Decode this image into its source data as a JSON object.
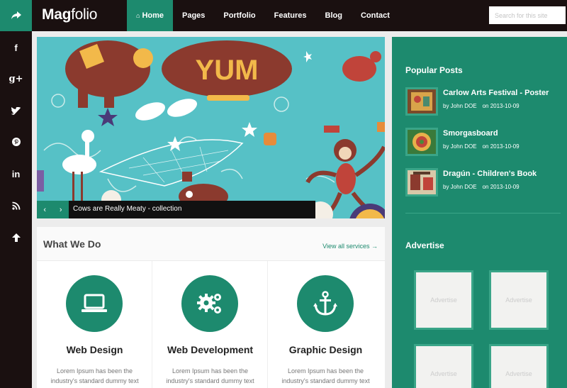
{
  "header": {
    "logo_bold": "Mag",
    "logo_rest": "folio",
    "nav": [
      {
        "label": "Home",
        "icon": "home-icon"
      },
      {
        "label": "Pages"
      },
      {
        "label": "Portfolio"
      },
      {
        "label": "Features"
      },
      {
        "label": "Blog"
      },
      {
        "label": "Contact"
      }
    ],
    "search_placeholder": "Search for this site"
  },
  "social": [
    "f",
    "g+",
    "twitter",
    "pinterest",
    "in",
    "rss",
    "up"
  ],
  "hero": {
    "banner_text": "YUM",
    "caption": "Cows are Really Meaty - collection"
  },
  "services": {
    "title": "What We Do",
    "view_all": "View all services →",
    "items": [
      {
        "name": "Web Design",
        "icon": "laptop-icon",
        "desc_line1": "Lorem Ipsum has been the",
        "desc_line2": "industry's standard dummy text"
      },
      {
        "name": "Web Development",
        "icon": "gears-icon",
        "desc_line1": "Lorem Ipsum has been the",
        "desc_line2": "industry's standard dummy text"
      },
      {
        "name": "Graphic Design",
        "icon": "anchor-icon",
        "desc_line1": "Lorem Ipsum has been the",
        "desc_line2": "industry's standard dummy text"
      }
    ]
  },
  "sidebar": {
    "popular_title": "Popular Posts",
    "posts": [
      {
        "title": "Carlow Arts Festival - Poster",
        "author": "by John DOE",
        "date": "on 2013-10-09"
      },
      {
        "title": "Smorgasboard",
        "author": "by John DOE",
        "date": "on 2013-10-09"
      },
      {
        "title": "Dragún - Children's Book",
        "author": "by John DOE",
        "date": "on 2013-10-09"
      }
    ],
    "advertise_title": "Advertise",
    "ad_label": "Advertise"
  },
  "colors": {
    "accent": "#1d8a6e",
    "dark": "#1a1010"
  }
}
